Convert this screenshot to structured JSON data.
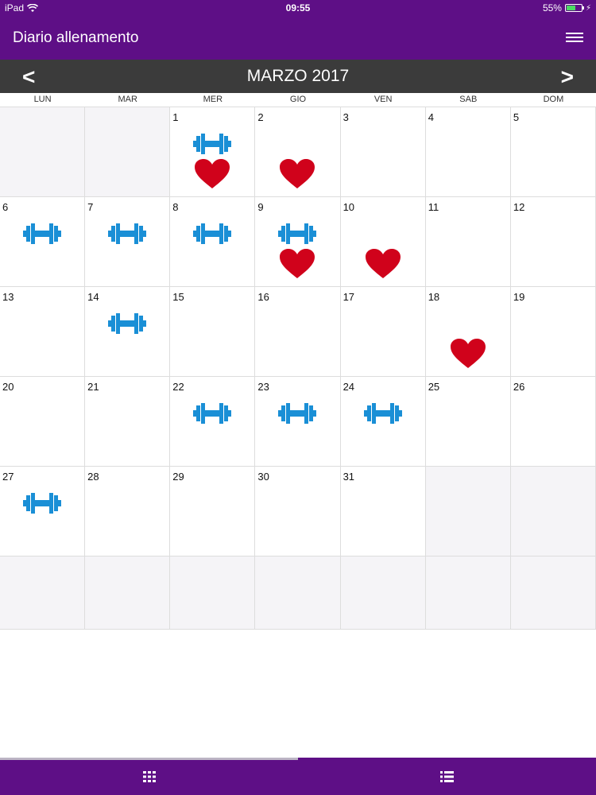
{
  "status_bar": {
    "device": "iPad",
    "time": "09:55",
    "battery": "55%"
  },
  "header": {
    "title": "Diario allenamento",
    "menu_icon": "hamburger-menu-icon"
  },
  "month_nav": {
    "prev": "<",
    "title": "MARZO 2017",
    "next": ">"
  },
  "weekdays": [
    "LUN",
    "MAR",
    "MER",
    "GIO",
    "VEN",
    "SAB",
    "DOM"
  ],
  "colors": {
    "primary": "#5e0f86",
    "month_bar": "#3b3b3b",
    "dumbbell": "#1a8fd6",
    "heart": "#d0021b",
    "empty_cell": "#f5f4f7"
  },
  "calendar": {
    "rows": [
      [
        {
          "day": "",
          "icons": []
        },
        {
          "day": "",
          "icons": []
        },
        {
          "day": "1",
          "icons": [
            "dumbbell",
            "heart"
          ]
        },
        {
          "day": "2",
          "icons": [
            "",
            "heart"
          ]
        },
        {
          "day": "3",
          "icons": []
        },
        {
          "day": "4",
          "icons": []
        },
        {
          "day": "5",
          "icons": []
        }
      ],
      [
        {
          "day": "6",
          "icons": [
            "dumbbell"
          ]
        },
        {
          "day": "7",
          "icons": [
            "dumbbell"
          ]
        },
        {
          "day": "8",
          "icons": [
            "dumbbell"
          ]
        },
        {
          "day": "9",
          "icons": [
            "dumbbell",
            "heart"
          ]
        },
        {
          "day": "10",
          "icons": [
            "",
            "heart"
          ]
        },
        {
          "day": "11",
          "icons": []
        },
        {
          "day": "12",
          "icons": []
        }
      ],
      [
        {
          "day": "13",
          "icons": []
        },
        {
          "day": "14",
          "icons": [
            "dumbbell"
          ]
        },
        {
          "day": "15",
          "icons": []
        },
        {
          "day": "16",
          "icons": []
        },
        {
          "day": "17",
          "icons": []
        },
        {
          "day": "18",
          "icons": [
            "",
            "heart"
          ]
        },
        {
          "day": "19",
          "icons": []
        }
      ],
      [
        {
          "day": "20",
          "icons": []
        },
        {
          "day": "21",
          "icons": []
        },
        {
          "day": "22",
          "icons": [
            "dumbbell"
          ]
        },
        {
          "day": "23",
          "icons": [
            "dumbbell"
          ]
        },
        {
          "day": "24",
          "icons": [
            "dumbbell"
          ]
        },
        {
          "day": "25",
          "icons": []
        },
        {
          "day": "26",
          "icons": []
        }
      ],
      [
        {
          "day": "27",
          "icons": [
            "dumbbell"
          ]
        },
        {
          "day": "28",
          "icons": []
        },
        {
          "day": "29",
          "icons": []
        },
        {
          "day": "30",
          "icons": []
        },
        {
          "day": "31",
          "icons": []
        },
        {
          "day": "",
          "icons": []
        },
        {
          "day": "",
          "icons": []
        }
      ],
      [
        {
          "day": "",
          "icons": []
        },
        {
          "day": "",
          "icons": []
        },
        {
          "day": "",
          "icons": []
        },
        {
          "day": "",
          "icons": []
        },
        {
          "day": "",
          "icons": []
        },
        {
          "day": "",
          "icons": []
        },
        {
          "day": "",
          "icons": []
        }
      ]
    ]
  },
  "bottom_tabs": [
    {
      "icon": "grid-icon",
      "active": true
    },
    {
      "icon": "list-icon",
      "active": false
    }
  ]
}
